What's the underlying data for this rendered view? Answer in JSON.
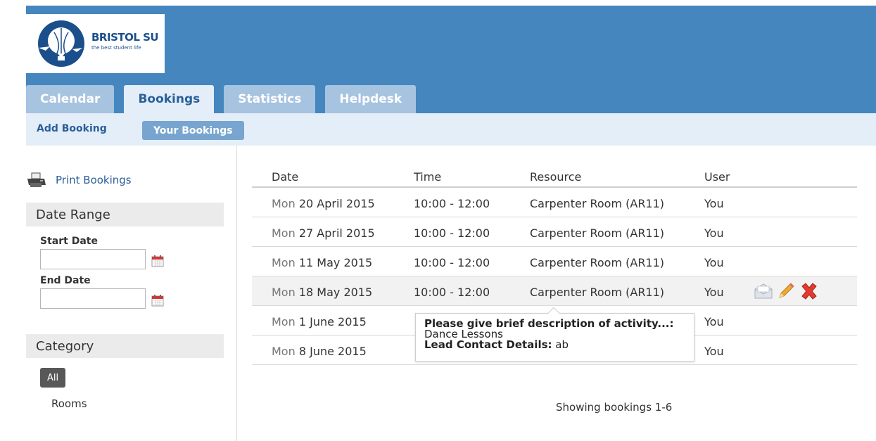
{
  "brand": {
    "title": "BRISTOL SU",
    "subtitle": "the best student life"
  },
  "tabs": [
    {
      "label": "Calendar",
      "active": false
    },
    {
      "label": "Bookings",
      "active": true
    },
    {
      "label": "Statistics",
      "active": false
    },
    {
      "label": "Helpdesk",
      "active": false
    }
  ],
  "subnav": {
    "add_booking": "Add Booking",
    "your_bookings": "Your Bookings"
  },
  "sidebar": {
    "print_label": "Print Bookings",
    "date_range": {
      "title": "Date Range",
      "start_label": "Start Date",
      "start_value": "",
      "end_label": "End Date",
      "end_value": ""
    },
    "category": {
      "title": "Category",
      "all_label": "All",
      "rooms_label": "Rooms"
    }
  },
  "table": {
    "headers": [
      "Date",
      "Time",
      "Resource",
      "User"
    ],
    "rows": [
      {
        "day": "Mon",
        "date": "20 April 2015",
        "time": "10:00 - 12:00",
        "resource": "Carpenter Room (AR11)",
        "user": "You"
      },
      {
        "day": "Mon",
        "date": "27 April 2015",
        "time": "10:00 - 12:00",
        "resource": "Carpenter Room (AR11)",
        "user": "You"
      },
      {
        "day": "Mon",
        "date": "11 May 2015",
        "time": "10:00 - 12:00",
        "resource": "Carpenter Room (AR11)",
        "user": "You"
      },
      {
        "day": "Mon",
        "date": "18 May 2015",
        "time": "10:00 - 12:00",
        "resource": "Carpenter Room (AR11)",
        "user": "You"
      },
      {
        "day": "Mon",
        "date": "1 June 2015",
        "time": "",
        "resource": "",
        "user": "You"
      },
      {
        "day": "Mon",
        "date": "8 June 2015",
        "time": "",
        "resource": "",
        "user": "You"
      }
    ],
    "footer": "Showing bookings 1-6"
  },
  "tooltip": {
    "question_label": "Please give brief description of activity...:",
    "question_answer": "Dance Lessons",
    "contact_label": "Lead Contact Details:",
    "contact_value": "ab"
  },
  "colors": {
    "header_bg": "#4586bf",
    "tab_active_bg": "#e3eef9",
    "subnav_bg": "#e3eef9",
    "accent_text": "#2a5f99"
  }
}
